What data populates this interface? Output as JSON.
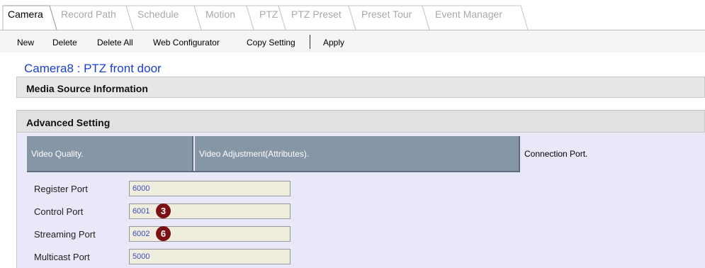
{
  "tabs": [
    {
      "label": "Camera",
      "active": true
    },
    {
      "label": "Record Path",
      "active": false
    },
    {
      "label": "Schedule",
      "active": false
    },
    {
      "label": "Motion",
      "active": false
    },
    {
      "label": "PTZ",
      "active": false
    },
    {
      "label": "PTZ Preset",
      "active": false
    },
    {
      "label": "Preset Tour",
      "active": false
    },
    {
      "label": "Event Manager",
      "active": false
    }
  ],
  "toolbar": {
    "new": "New",
    "delete": "Delete",
    "delete_all": "Delete All",
    "web_configurator": "Web Configurator",
    "copy_setting": "Copy Setting",
    "apply": "Apply"
  },
  "page_title": "Camera8 : PTZ front door",
  "sections": {
    "media_source": "Media Source Information",
    "advanced": "Advanced Setting"
  },
  "sub_tabs": {
    "video_quality": "Video Quality.",
    "video_adjustment": "Video Adjustment(Attributes).",
    "connection_port": "Connection Port."
  },
  "fields": {
    "register_port": {
      "label": "Register Port",
      "value": "6000"
    },
    "control_port": {
      "label": "Control Port",
      "value": "6001",
      "badge": "3"
    },
    "streaming_port": {
      "label": "Streaming Port",
      "value": "6002",
      "badge": "6"
    },
    "multicast_port": {
      "label": "Multicast Port",
      "value": "5000"
    }
  },
  "colors": {
    "title_blue": "#1a3fd0",
    "badge_red": "#7b1115",
    "inactive_tab": "#8796a6",
    "panel_bg": "#e8e8f8",
    "input_bg": "#efedde"
  }
}
